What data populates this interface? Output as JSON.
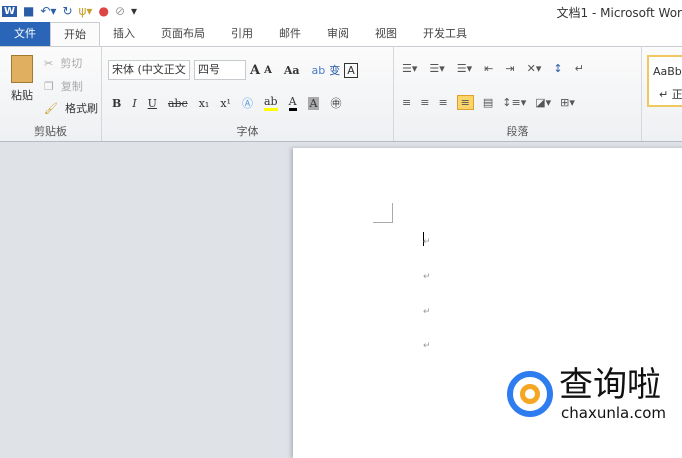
{
  "window": {
    "title": "文档1 - Microsoft Wor"
  },
  "qat": {
    "icons": [
      "word-icon",
      "save-icon",
      "undo-icon",
      "redo-icon",
      "format-icon",
      "color-icon",
      "clear-icon",
      "customize-icon"
    ]
  },
  "tabs": [
    "文件",
    "开始",
    "插入",
    "页面布局",
    "引用",
    "邮件",
    "审阅",
    "视图",
    "开发工具"
  ],
  "clipboard": {
    "paste": "粘贴",
    "cut": "剪切",
    "copy": "复制",
    "format_painter": "格式刷",
    "label": "剪贴板"
  },
  "font": {
    "name": "宋体 (中文正文",
    "size": "四号",
    "grow": "A",
    "shrink": "A",
    "case": "Aa",
    "bold": "B",
    "italic": "I",
    "underline": "U",
    "strike": "abc",
    "sub": "x₁",
    "sup": "x¹",
    "color_a": "A",
    "label": "字体"
  },
  "paragraph": {
    "label": "段落"
  },
  "styles": {
    "preview": "AaBbC",
    "name": "↵ 正"
  },
  "document": {
    "marks": [
      "↵",
      "↵",
      "↵",
      "↵"
    ]
  },
  "watermark": {
    "brand": "查询啦",
    "url": "chaxunla.com"
  }
}
